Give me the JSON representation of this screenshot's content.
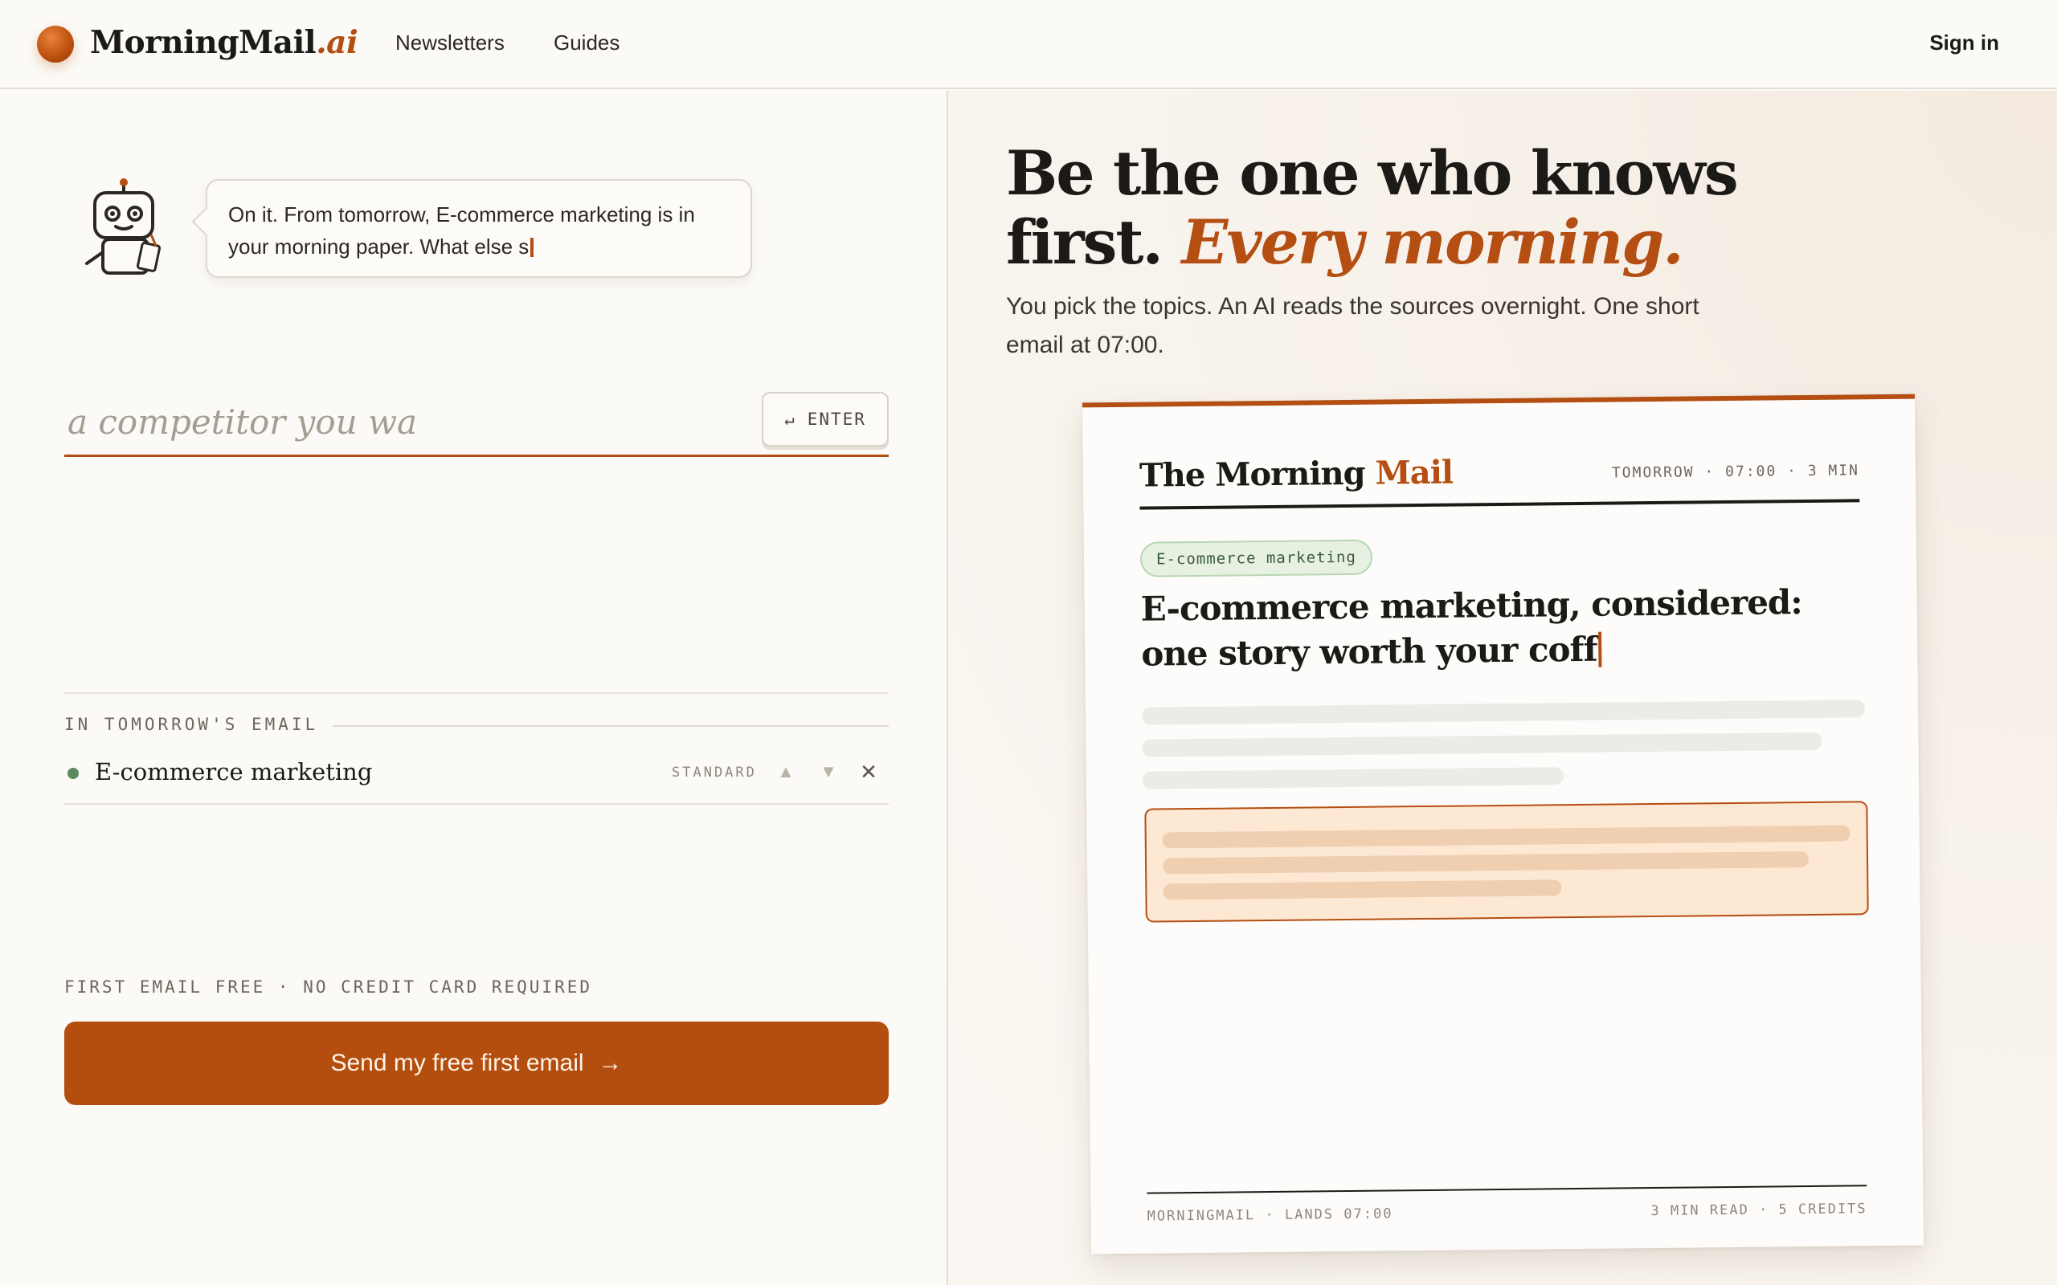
{
  "brand": {
    "name": "MorningMail",
    "suffix": ".ai",
    "accent": "#b44e12"
  },
  "nav": {
    "items": [
      {
        "label": "Newsletters"
      },
      {
        "label": "Guides"
      }
    ],
    "signin": "Sign in"
  },
  "assistant": {
    "icon": "robot-icon",
    "message": "On it. From tomorrow, E-commerce marketing is in your morning paper. What else s"
  },
  "topic_input": {
    "value": "",
    "placeholder": "a competitor you wa",
    "enter_label": "ENTER",
    "enter_icon": "return-icon"
  },
  "tomorrow": {
    "label": "IN TOMORROW'S EMAIL",
    "topics": [
      {
        "name": "E-commerce marketing",
        "tier": "STANDARD",
        "status_color": "#5b8a5c"
      }
    ],
    "controls": {
      "up": "▲",
      "down": "▼",
      "remove": "✕"
    }
  },
  "cta": {
    "note": "FIRST EMAIL FREE · NO CREDIT CARD REQUIRED",
    "label": "Send my free first email",
    "arrow": "→"
  },
  "hero": {
    "title_plain": "Be the one who knows first.",
    "title_accent": "Every morning.",
    "subtitle": "You pick the topics. An AI reads the sources overnight. One short email at 07:00."
  },
  "preview": {
    "title_a": "The Morning",
    "title_b": "Mail",
    "meta": "TOMORROW · 07:00 · 3 MIN",
    "tag": "E-commerce marketing",
    "headline": "E-commerce marketing, considered: one story worth your coff",
    "footer_left": "MORNINGMAIL · LANDS 07:00",
    "footer_right": "3 MIN READ · 5 CREDITS"
  }
}
